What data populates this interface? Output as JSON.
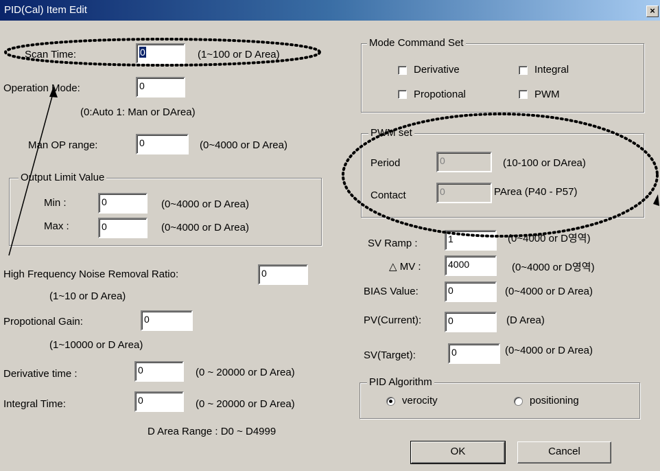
{
  "window": {
    "title": "PID(Cal) Item Edit",
    "close_glyph": "×"
  },
  "left": {
    "scan_time": {
      "label": "Scan Time:",
      "value": "0",
      "hint": "(1~100 or D Area)"
    },
    "operation_mode": {
      "label": "Operation Mode:",
      "value": "0",
      "hint": "(0:Auto 1: Man or DArea)"
    },
    "man_op_range": {
      "label": "Man OP range:",
      "value": "0",
      "hint": "(0~4000 or D Area)"
    },
    "output_limit": {
      "legend": "Output Limit Value",
      "min": {
        "label": "Min :",
        "value": "0",
        "hint": "(0~4000 or D Area)"
      },
      "max": {
        "label": "Max :",
        "value": "0",
        "hint": "(0~4000 or D Area)"
      }
    },
    "noise_ratio": {
      "label": "High Frequency Noise Removal Ratio:",
      "value": "0",
      "hint": "(1~10 or D Area)"
    },
    "prop_gain": {
      "label": "Propotional Gain:",
      "value": "0",
      "hint": "(1~10000  or D Area)"
    },
    "derivative_time": {
      "label": "Derivative time :",
      "value": "0",
      "hint": "(0 ~ 20000 or D Area)"
    },
    "integral_time": {
      "label": "Integral Time:",
      "value": "0",
      "hint": "(0 ~ 20000 or D Area)"
    },
    "d_area_range": "D Area Range : D0 ~ D4999"
  },
  "right": {
    "mode_command": {
      "legend": "Mode Command Set",
      "derivative": "Derivative",
      "integral": "Integral",
      "propotional": "Propotional",
      "pwm": "PWM"
    },
    "pwm_set": {
      "legend": "PWM set",
      "period": {
        "label": "Period",
        "value": "0",
        "hint": "(10-100 or DArea)"
      },
      "contact": {
        "label": "Contact",
        "value": "0",
        "hint": "PArea (P40 - P57)"
      }
    },
    "sv_ramp": {
      "label": "SV Ramp :",
      "value": "1",
      "hint": "(0~4000 or D영역)"
    },
    "delta_mv": {
      "label": "△ MV :",
      "value": "4000",
      "hint": "(0~4000 or D영역)"
    },
    "bias_value": {
      "label": "BIAS Value:",
      "value": "0",
      "hint": "(0~4000 or D Area)"
    },
    "pv_current": {
      "label": "PV(Current):",
      "value": "0",
      "hint": "(D Area)"
    },
    "sv_target": {
      "label": "SV(Target):",
      "value": "0",
      "hint": "(0~4000 or D Area)"
    },
    "pid_algorithm": {
      "legend": "PID Algorithm",
      "verocity": "verocity",
      "positioning": "positioning"
    }
  },
  "buttons": {
    "ok": "OK",
    "cancel": "Cancel"
  },
  "colors": {
    "annotation": "#000000",
    "title_start": "#0a246a",
    "title_end": "#a6caf0"
  }
}
